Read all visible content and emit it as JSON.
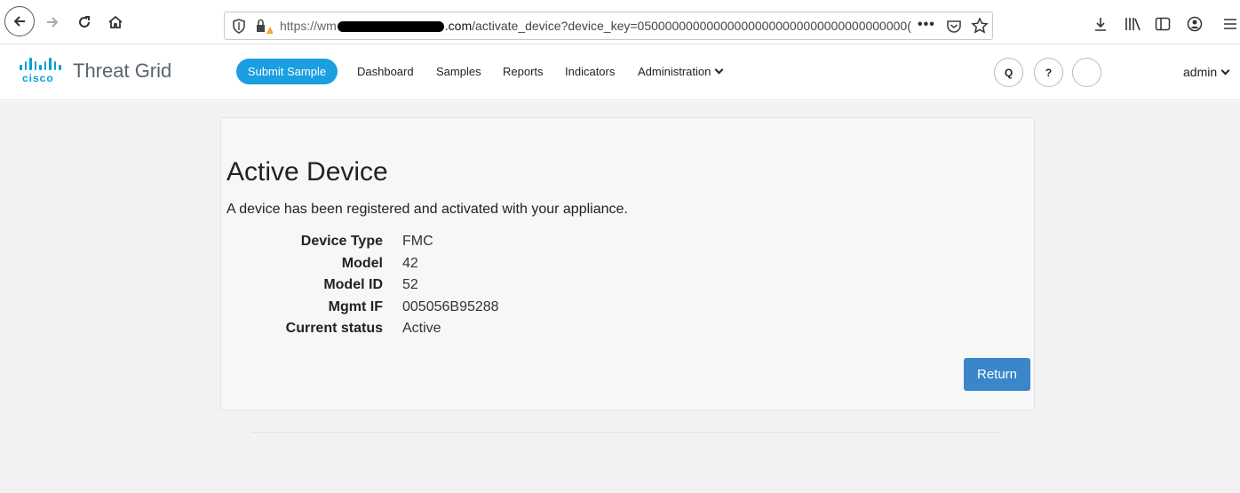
{
  "browser": {
    "url_protocol": "https://wm",
    "url_domain": ".com",
    "url_path": "/activate_device?device_key=050000000000000000000000000000000000000(",
    "more_glyph": "•••"
  },
  "header": {
    "brand_cisco": "cisco",
    "product_name": "Threat Grid",
    "submit_label": "Submit Sample",
    "nav": {
      "dashboard": "Dashboard",
      "samples": "Samples",
      "reports": "Reports",
      "indicators": "Indicators",
      "administration": "Administration"
    },
    "search_glyph": "Q",
    "help_glyph": "?",
    "user": "admin",
    "accent_color": "#1a9fe0"
  },
  "page": {
    "title": "Active Device",
    "description": "A device has been registered and activated with your appliance.",
    "details": [
      {
        "label": "Device Type",
        "value": "FMC"
      },
      {
        "label": "Model",
        "value": "42"
      },
      {
        "label": "Model ID",
        "value": "52"
      },
      {
        "label": "Mgmt IF",
        "value": "005056B95288"
      },
      {
        "label": "Current status",
        "value": "Active"
      }
    ],
    "return_label": "Return"
  },
  "icons": [
    "back-arrow-icon",
    "forward-arrow-icon",
    "reload-icon",
    "home-icon",
    "shield-icon",
    "warning-lock-icon",
    "pocket-icon",
    "star-icon",
    "download-icon",
    "library-icon",
    "sidebar-icon",
    "account-icon",
    "hamburger-menu-icon"
  ]
}
